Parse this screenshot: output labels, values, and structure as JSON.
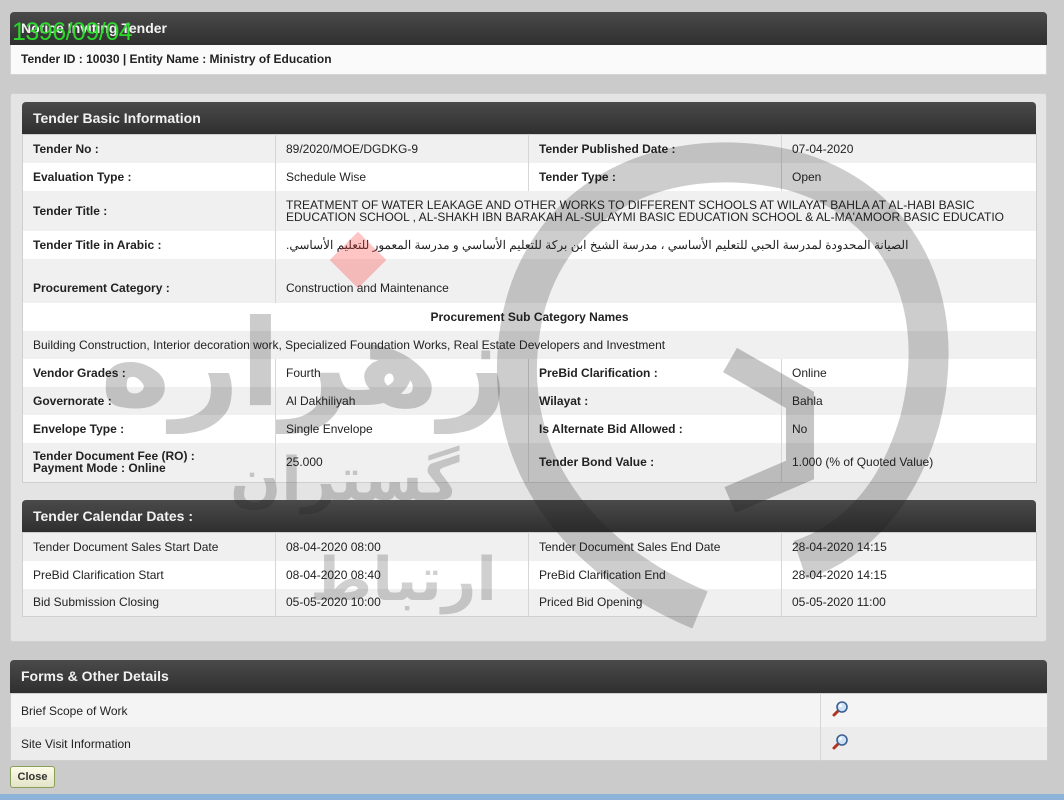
{
  "stamp": "1396/09/04",
  "notice": {
    "title": "Notice Inviting Tender",
    "sub_prefix_id": "Tender ID : ",
    "tender_id": "10030",
    "sub_sep": " | Entity Name : ",
    "entity": "Ministry of Education"
  },
  "basic": {
    "title": "Tender Basic Information",
    "tender_no_label": "Tender No :",
    "tender_no": "89/2020/MOE/DGDKG-9",
    "published_label": "Tender Published Date :",
    "published": "07-04-2020",
    "eval_label": "Evaluation Type :",
    "eval": "Schedule Wise",
    "type_label": "Tender Type :",
    "type": "Open",
    "title_label": "Tender Title :",
    "tender_title": "TREATMENT OF WATER LEAKAGE AND OTHER WORKS TO DIFFERENT SCHOOLS AT WILAYAT BAHLA AT AL-HABI BASIC EDUCATION SCHOOL , AL-SHAKH IBN BARAKAH AL-SULAYMI BASIC EDUCATION SCHOOL & AL-MA'AMOOR BASIC EDUCATIO",
    "title_ar_label": "Tender Title in Arabic :",
    "title_ar": "الصيانة المحدودة لمدرسة الحبي للتعليم الأساسي ، مدرسة الشيخ ابن بركة للتعليم الأساسي و مدرسة المعمور للتعليم الأساسي.",
    "proc_cat_label": "Procurement Category :",
    "proc_cat": "Construction and Maintenance",
    "sub_cat_header": "Procurement Sub Category Names",
    "sub_cats": "Building Construction, Interior decoration work, Specialized Foundation Works, Real Estate Developers and Investment",
    "grades_label": "Vendor Grades :",
    "grades": "Fourth",
    "prebid_label": "PreBid Clarification :",
    "prebid": "Online",
    "gov_label": "Governorate :",
    "gov": "Al Dakhiliyah",
    "wilayat_label": "Wilayat :",
    "wilayat": "Bahla",
    "envelope_label": "Envelope Type :",
    "envelope": "Single Envelope",
    "alt_bid_label": "Is Alternate Bid Allowed :",
    "alt_bid": "No",
    "fee_label": "Tender Document Fee (RO) :",
    "payment_label": "Payment Mode :  Online",
    "fee": "25.000",
    "bond_label": "Tender Bond Value :",
    "bond": "1.000 (% of Quoted Value)"
  },
  "calendar": {
    "title": "Tender Calendar Dates :",
    "rows": [
      {
        "l1": "Tender Document Sales Start Date",
        "v1": "08-04-2020 08:00",
        "l2": "Tender Document Sales End Date",
        "v2": "28-04-2020 14:15"
      },
      {
        "l1": "PreBid Clarification Start",
        "v1": "08-04-2020 08:40",
        "l2": "PreBid Clarification End",
        "v2": "28-04-2020 14:15"
      },
      {
        "l1": "Bid Submission Closing",
        "v1": "05-05-2020 10:00",
        "l2": "Priced Bid Opening",
        "v2": "05-05-2020 11:00"
      }
    ]
  },
  "forms": {
    "title": "Forms & Other Details",
    "items": [
      {
        "label": "Brief Scope of Work",
        "icon": "magnifier-icon"
      },
      {
        "label": "Site Visit Information",
        "icon": "magnifier-icon"
      }
    ]
  },
  "close_label": "Close",
  "watermark": {
    "text_main": "زهراره",
    "text_2": "گستران",
    "text_3": "ارتباط"
  }
}
